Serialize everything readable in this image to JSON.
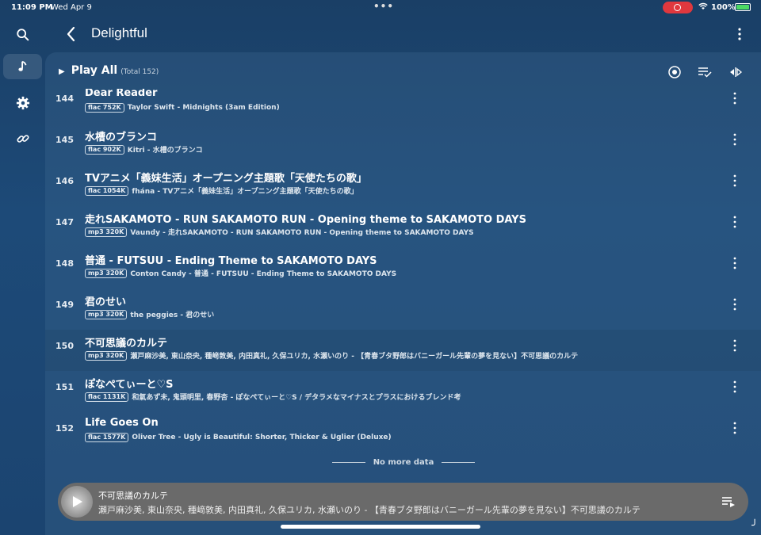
{
  "status_bar": {
    "time": "11:09 PM",
    "date": "Wed Apr 9",
    "battery": "100%"
  },
  "sidebar": {
    "items": [
      {
        "icon": "search-icon"
      },
      {
        "icon": "music-note-icon",
        "active": true
      },
      {
        "icon": "gear-icon"
      },
      {
        "icon": "link-icon"
      }
    ]
  },
  "header": {
    "title": "Delightful"
  },
  "toolbar": {
    "play_all_label": "Play All",
    "total_label": "(Total 152)"
  },
  "tracks": [
    {
      "num": "144",
      "title": "Dear Reader",
      "badge": "flac 752K",
      "meta": "Taylor Swift - Midnights (3am Edition)"
    },
    {
      "num": "145",
      "title": "水槽のブランコ",
      "badge": "flac 902K",
      "meta": "Kitri - 水槽のブランコ"
    },
    {
      "num": "146",
      "title": "TVアニメ「義妹生活」オープニング主題歌「天使たちの歌」",
      "badge": "flac 1054K",
      "meta": "fhána - TVアニメ「義妹生活」オープニング主題歌「天使たちの歌」"
    },
    {
      "num": "147",
      "title": "走れSAKAMOTO - RUN SAKAMOTO RUN - Opening theme to SAKAMOTO DAYS",
      "badge": "mp3 320K",
      "meta": "Vaundy - 走れSAKAMOTO - RUN SAKAMOTO RUN - Opening theme to SAKAMOTO DAYS"
    },
    {
      "num": "148",
      "title": "普通 - FUTSUU - Ending Theme to SAKAMOTO DAYS",
      "badge": "mp3 320K",
      "meta": "Conton Candy - 普通 - FUTSUU - Ending Theme to SAKAMOTO DAYS"
    },
    {
      "num": "149",
      "title": "君のせい",
      "badge": "mp3 320K",
      "meta": "the peggies - 君のせい"
    },
    {
      "num": "150",
      "title": "不可思議のカルテ",
      "badge": "mp3 320K",
      "meta": "瀬戸麻沙美, 東山奈央, 種﨑敦美, 内田真礼, 久保ユリカ, 水瀬いのり - 【青春ブタ野郎はバニーガール先輩の夢を見ない】不可思議のカルテ"
    },
    {
      "num": "151",
      "title": "ぽなぺてぃーと♡S",
      "badge": "flac 1131K",
      "meta": "和氣あず未, 鬼頭明里, 春野杏 - ぽなぺてぃーと♡S / デタラメなマイナスとプラスにおけるブレンド考"
    },
    {
      "num": "152",
      "title": "Life Goes On",
      "badge": "flac 1577K",
      "meta": "Oliver Tree - Ugly is Beautiful: Shorter, Thicker & Uglier (Deluxe)"
    }
  ],
  "footer_text": "No more data",
  "player": {
    "title": "不可思議のカルテ",
    "artist": "瀬戸麻沙美, 東山奈央, 種﨑敦美, 内田真礼, 久保ユリカ, 水瀬いのり - 【青春ブタ野郎はバニーガール先輩の夢を見ない】不可思議のカルテ"
  }
}
